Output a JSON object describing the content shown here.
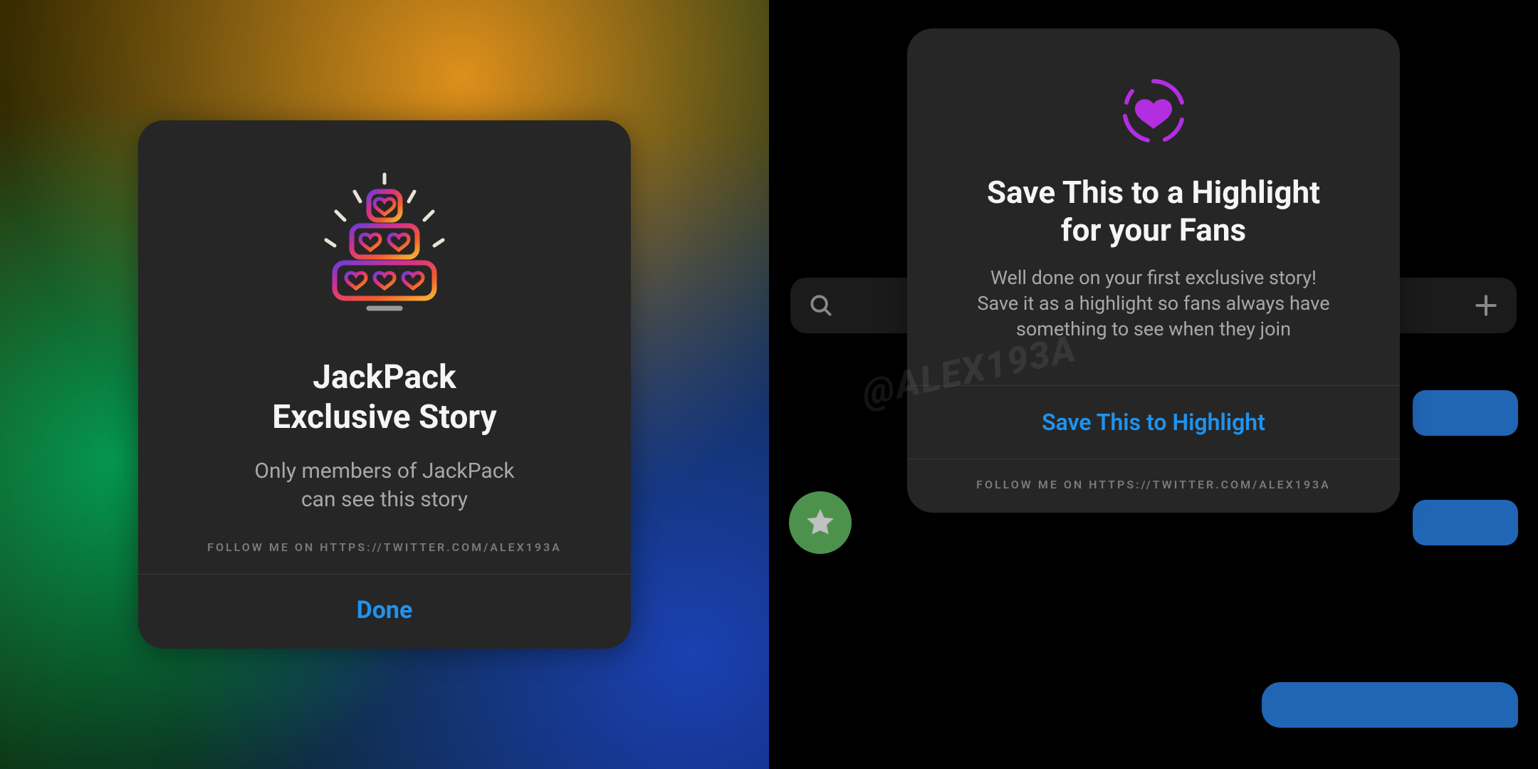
{
  "watermark": "@ALEX193A",
  "left_card": {
    "icon_name": "hearts-cake-icon",
    "title_line1": "JackPack",
    "title_line2": "Exclusive Story",
    "subtitle_line1": "Only members of JackPack",
    "subtitle_line2": "can see this story",
    "follow": "FOLLOW ME ON HTTPS://TWITTER.COM/ALEX193A",
    "action": "Done"
  },
  "right_bg": {
    "search_icon": "search-icon",
    "add_icon": "plus-icon",
    "star_icon": "star-icon"
  },
  "right_card": {
    "icon_name": "heart-ring-icon",
    "title_line1": "Save This to a Highlight",
    "title_line2": "for your Fans",
    "subtitle_line1": "Well done on your first exclusive story!",
    "subtitle_line2": "Save it as a highlight so fans always have",
    "subtitle_line3": "something to see when they join",
    "action": "Save This to Highlight",
    "follow": "FOLLOW ME ON HTTPS://TWITTER.COM/ALEX193A"
  },
  "colors": {
    "link_blue": "#1f93ef",
    "purple": "#b32ee0"
  }
}
